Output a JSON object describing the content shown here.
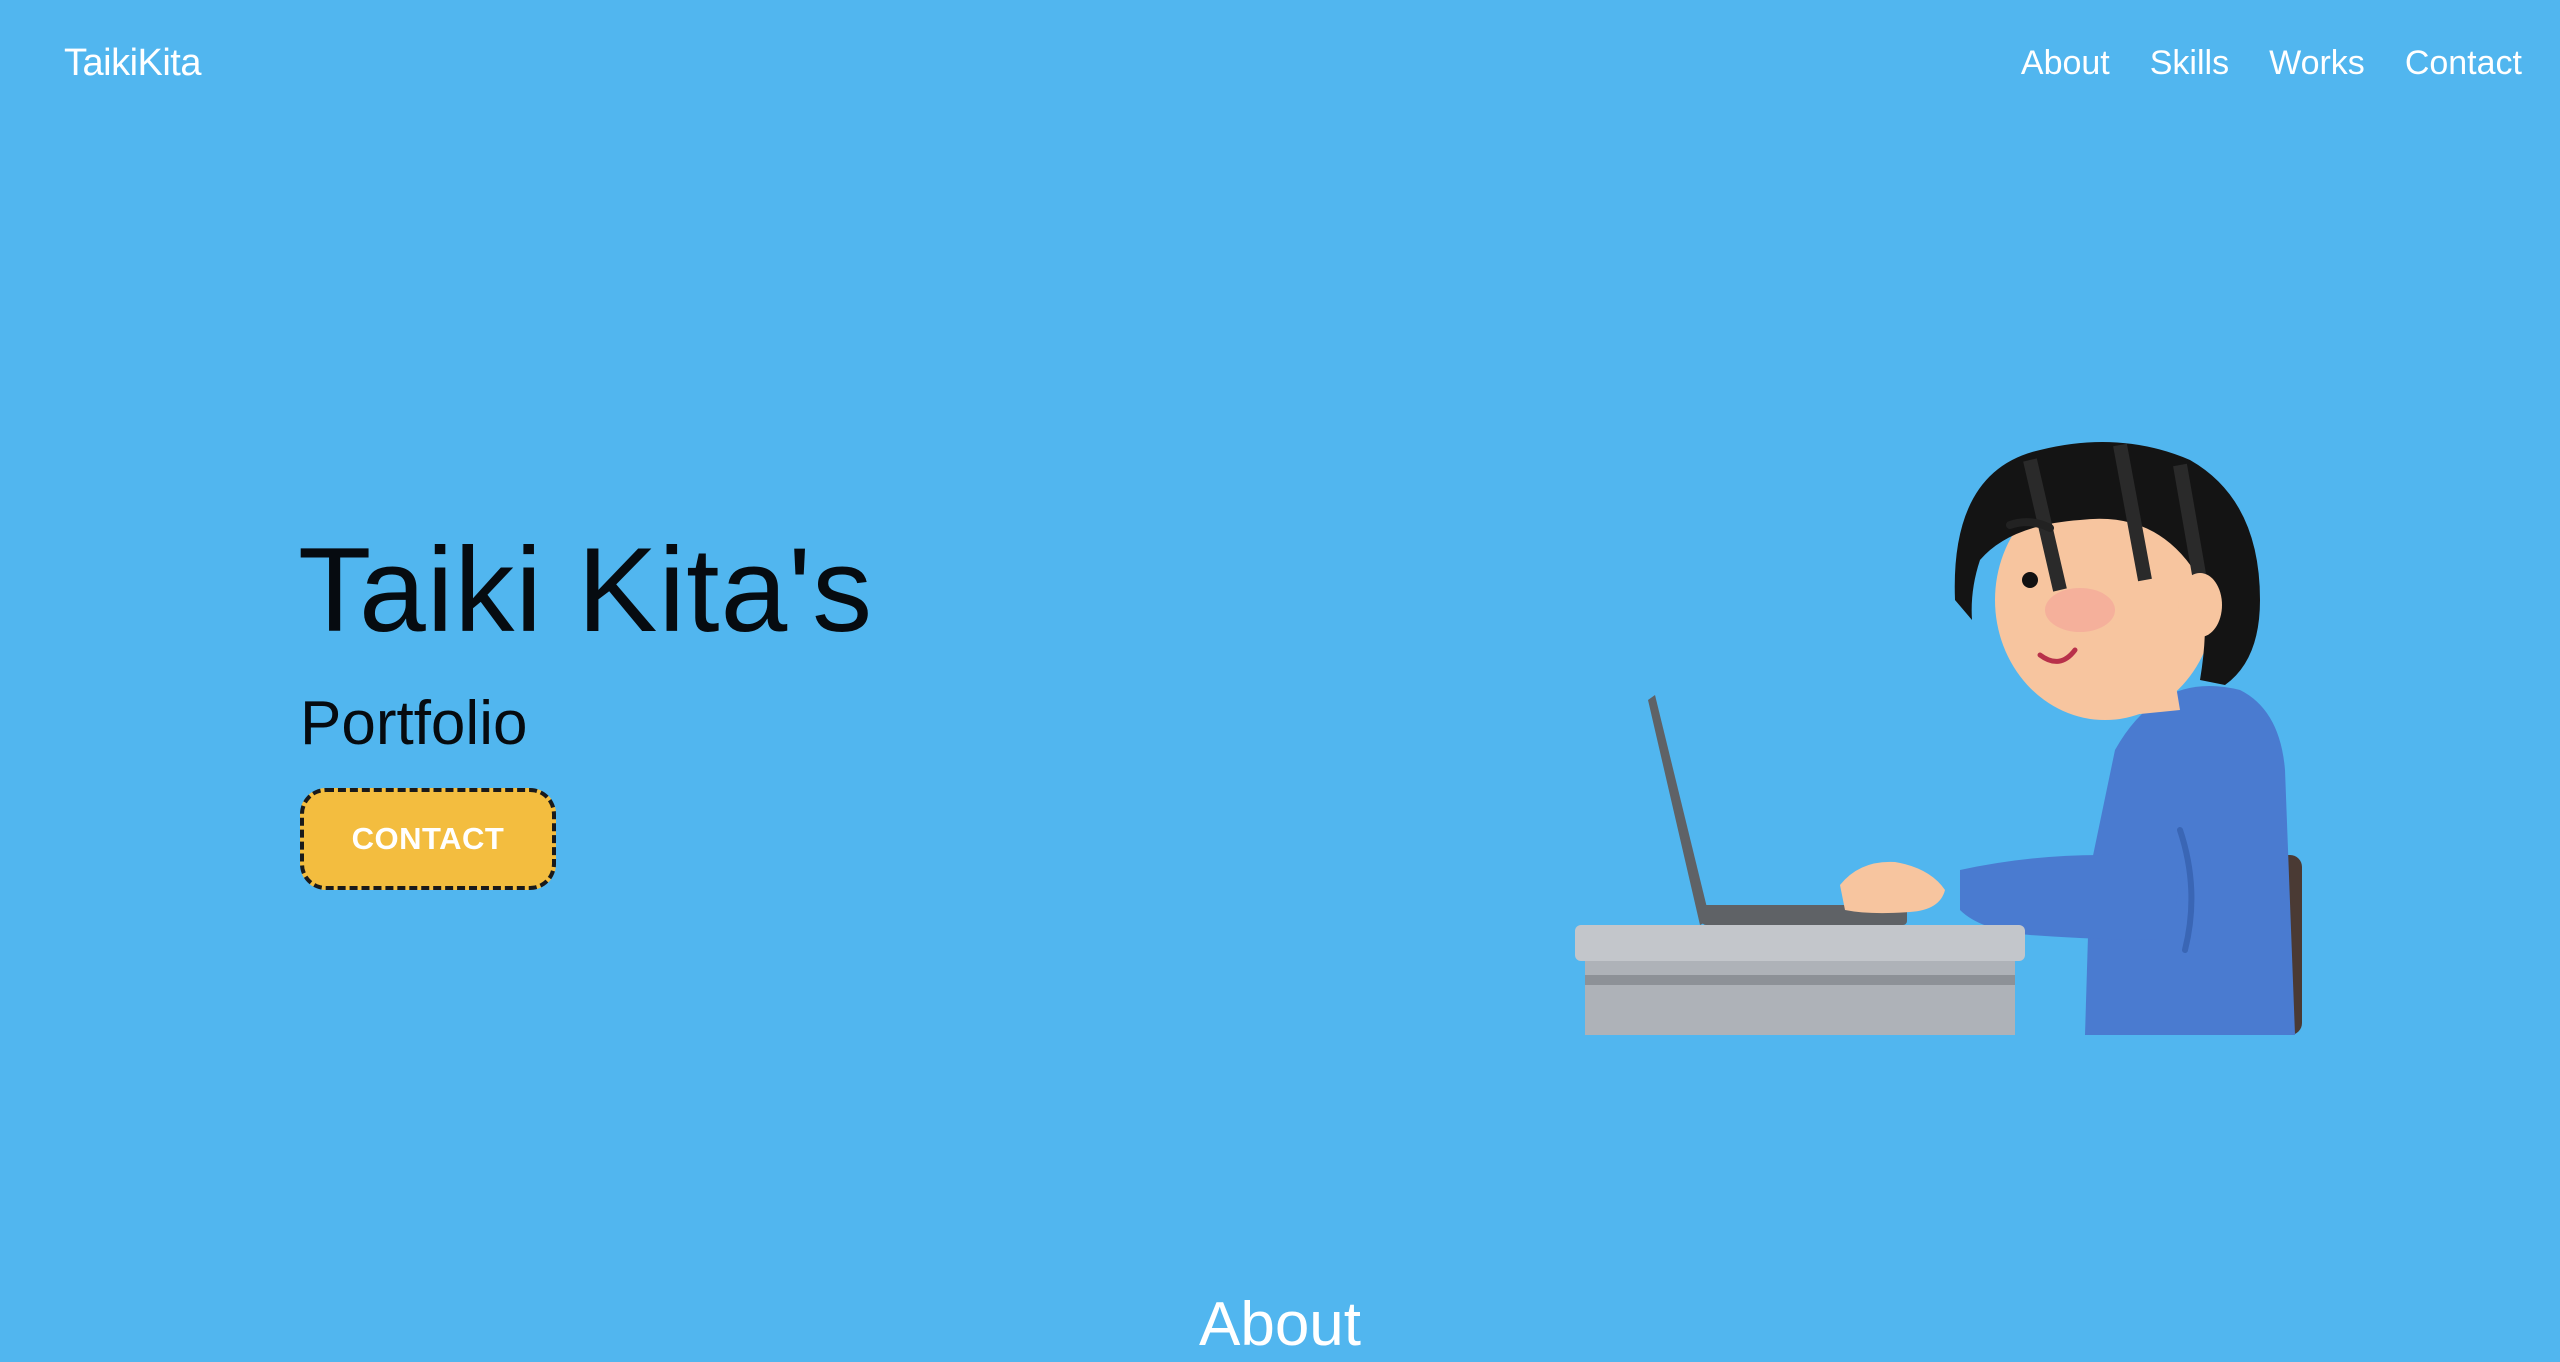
{
  "header": {
    "brand": "TaikiKita",
    "nav": [
      "About",
      "Skills",
      "Works",
      "Contact"
    ]
  },
  "hero": {
    "title": "Taiki Kita's",
    "subtitle": "Portfolio",
    "cta_label": "CONTACT",
    "illustration_icon": "person-typing-on-laptop-icon"
  },
  "sections": {
    "about_title": "About"
  },
  "colors": {
    "background": "#51b6ef",
    "cta_background": "#f3bd3f",
    "heading_text": "#060b10",
    "nav_text": "#ffffff"
  }
}
